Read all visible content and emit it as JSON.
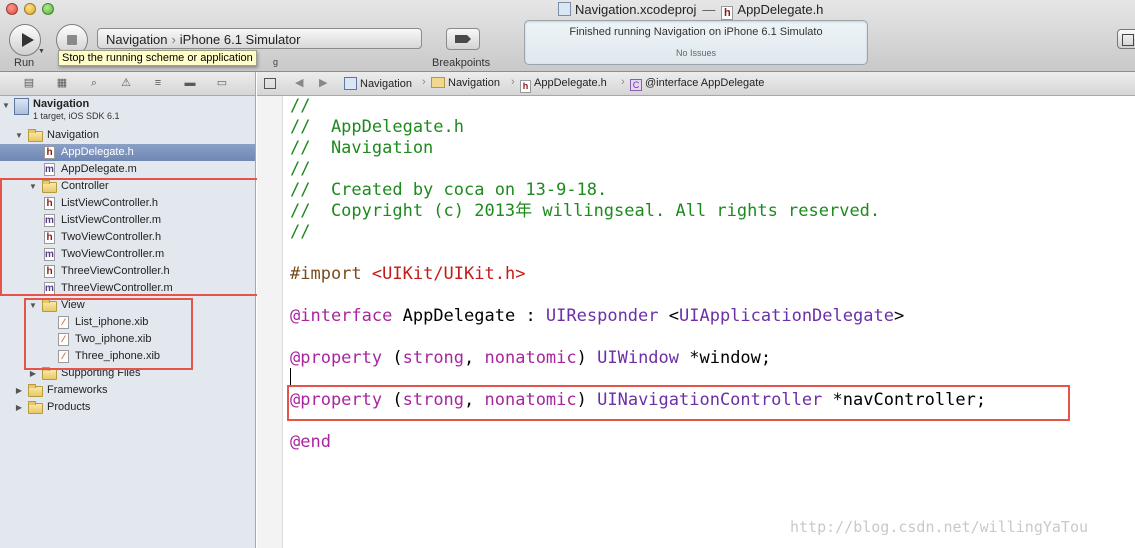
{
  "window": {
    "title_project": "Navigation.xcodeproj",
    "title_separator": "—",
    "title_file": "AppDelegate.h"
  },
  "toolbar": {
    "run_label": "Run",
    "scheme_target": "Navigation",
    "scheme_destination": "iPhone 6.1 Simulator",
    "tooltip": "Stop the running scheme or application",
    "breakpoints_label": "Breakpoints",
    "activity_message": "Finished running Navigation on iPhone 6.1 Simulato",
    "activity_issues": "No Issues"
  },
  "sidebar": {
    "project": {
      "name": "Navigation",
      "subtitle": "1 target, iOS SDK 6.1"
    },
    "items": [
      {
        "label": "Navigation",
        "kind": "folder",
        "level": 1,
        "expanded": true
      },
      {
        "label": "AppDelegate.h",
        "kind": "h",
        "level": 2,
        "selected": true
      },
      {
        "label": "AppDelegate.m",
        "kind": "m",
        "level": 2
      },
      {
        "label": "Controller",
        "kind": "folder",
        "level": 2,
        "expanded": true
      },
      {
        "label": "ListViewController.h",
        "kind": "h",
        "level": 3
      },
      {
        "label": "ListViewController.m",
        "kind": "m",
        "level": 3
      },
      {
        "label": "TwoViewController.h",
        "kind": "h",
        "level": 3
      },
      {
        "label": "TwoViewController.m",
        "kind": "m",
        "level": 3
      },
      {
        "label": "ThreeViewController.h",
        "kind": "h",
        "level": 3
      },
      {
        "label": "ThreeViewController.m",
        "kind": "m",
        "level": 3
      },
      {
        "label": "View",
        "kind": "folder",
        "level": 2,
        "expanded": true
      },
      {
        "label": "List_iphone.xib",
        "kind": "xib",
        "level": 3
      },
      {
        "label": "Two_iphone.xib",
        "kind": "xib",
        "level": 3
      },
      {
        "label": "Three_iphone.xib",
        "kind": "xib",
        "level": 3
      },
      {
        "label": "Supporting Files",
        "kind": "folder",
        "level": 2,
        "expanded": false
      },
      {
        "label": "Frameworks",
        "kind": "folder",
        "level": 1,
        "expanded": false
      },
      {
        "label": "Products",
        "kind": "folder",
        "level": 1,
        "expanded": false
      }
    ]
  },
  "jumpbar": {
    "project": "Navigation",
    "group": "Navigation",
    "file": "AppDelegate.h",
    "symbol": "@interface AppDelegate"
  },
  "editor": {
    "lines": {
      "l1": "//",
      "l2": "//  AppDelegate.h",
      "l3": "//  Navigation",
      "l4": "//",
      "l5": "//  Created by coca on 13-9-18.",
      "l6": "//  Copyright (c) 2013年 willingseal. All rights reserved.",
      "l7": "//",
      "import_kw": "#import",
      "import_path": "<UIKit/UIKit.h>",
      "interface_kw": "@interface",
      "interface_name": "AppDelegate",
      "interface_colon": " : ",
      "interface_super": "UIResponder",
      "interface_lt": " <",
      "interface_protocol": "UIApplicationDelegate",
      "interface_gt": ">",
      "property_kw": "@property",
      "paren_open": " (",
      "attr_strong": "strong",
      "comma": ", ",
      "attr_nonatomic": "nonatomic",
      "paren_close": ") ",
      "type_window": "UIWindow",
      "var_window": " *window;",
      "type_nav": "UINavigationController",
      "var_nav": " *navController;",
      "end_kw": "@end"
    }
  },
  "watermark": "http://blog.csdn.net/willingYaTou",
  "colors": {
    "comment": "#1e8a1e",
    "keyword": "#a9259f",
    "type": "#6b2fa8",
    "string": "#c41a16",
    "highlight_box": "#e5544b",
    "selection": "#7088b6"
  }
}
